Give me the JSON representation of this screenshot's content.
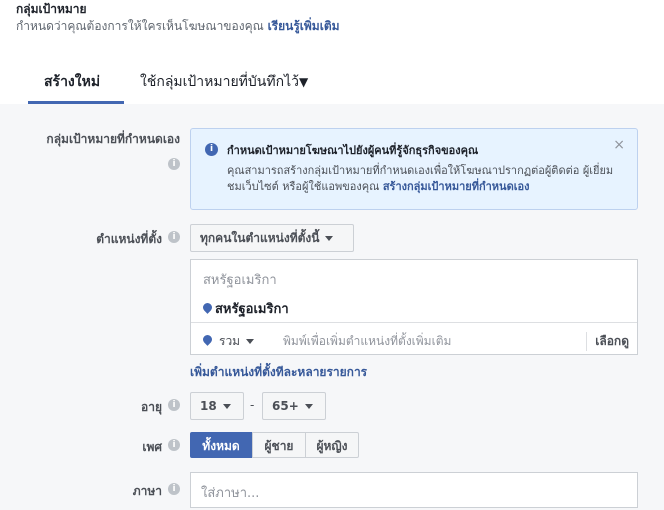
{
  "header": {
    "title": "กลุ่มเป้าหมาย",
    "subtitle": "กำหนดว่าคุณต้องการให้ใครเห็นโฆษณาของคุณ",
    "learn_more": "เรียนรู้เพิ่มเติม"
  },
  "tabs": {
    "create_new": "สร้างใหม่",
    "use_saved": "ใช้กลุ่มเป้าหมายที่บันทึกไว้"
  },
  "custom_audience": {
    "label": "กลุ่มเป้าหมายที่กำหนดเอง",
    "notice_title": "กำหนดเป้าหมายโฆษณาไปยังผู้คนที่รู้จักธุรกิจของคุณ",
    "notice_body": "คุณสามารถสร้างกลุ่มเป้าหมายที่กำหนดเองเพื่อให้โฆษณาปรากฏต่อผู้ติดต่อ ผู้เยี่ยมชมเว็บไซต์ หรือผู้ใช้แอพของคุณ",
    "notice_link": "สร้างกลุ่มเป้าหมายที่กำหนดเอง",
    "close": "×"
  },
  "location": {
    "label": "ตำแหน่งที่ตั้ง",
    "type_value": "ทุกคนในตำแหน่งที่ตั้งนี้",
    "country": "สหรัฐอเมริกา",
    "selected": "สหรัฐอเมริกา",
    "include": "รวม",
    "placeholder": "พิมพ์เพื่อเพิ่มตำแหน่งที่ตั้งเพิ่มเติม",
    "browse": "เลือกดู",
    "bulk_link": "เพิ่มตำแหน่งที่ตั้งทีละหลายรายการ"
  },
  "age": {
    "label": "อายุ",
    "min": "18",
    "max": "65+",
    "separator": "-"
  },
  "gender": {
    "label": "เพศ",
    "options": [
      "ทั้งหมด",
      "ผู้ชาย",
      "ผู้หญิง"
    ],
    "selected": "ทั้งหมด"
  },
  "language": {
    "label": "ภาษา",
    "placeholder": "ใส่ภาษา..."
  },
  "colors": {
    "accent": "#4267b2",
    "link": "#365899",
    "notice_bg": "#e7f3ff"
  }
}
